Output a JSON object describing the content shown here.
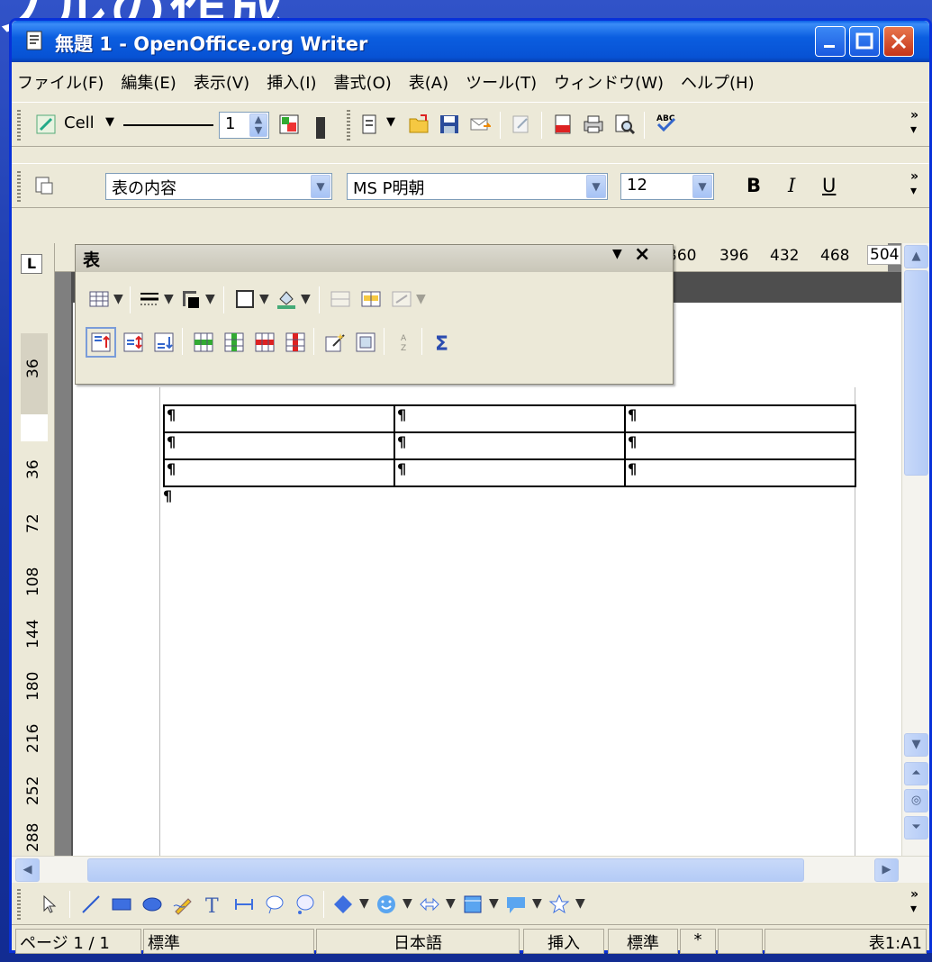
{
  "slide_title": "ブルの作成",
  "window": {
    "title": "無題 1 - OpenOffice.org Writer"
  },
  "menu": [
    "ファイル(F)",
    "編集(E)",
    "表示(V)",
    "挿入(I)",
    "書式(O)",
    "表(A)",
    "ツール(T)",
    "ウィンドウ(W)",
    "ヘルプ(H)"
  ],
  "table_toolbar": {
    "cell_label": "Cell",
    "line_width": "1"
  },
  "format_toolbar": {
    "style": "表の内容",
    "font": "MS P明朝",
    "size": "12",
    "bold": "B",
    "italic": "I",
    "underline": "U"
  },
  "horizontal_ruler": [
    "360",
    "396",
    "432",
    "468",
    "504"
  ],
  "vertical_ruler": [
    "36",
    "36",
    "72",
    "108",
    "144",
    "180",
    "216",
    "252",
    "288"
  ],
  "float_toolbar": {
    "title": "表"
  },
  "document": {
    "table_rows": [
      [
        "¶",
        "¶",
        "¶"
      ],
      [
        "¶",
        "¶",
        "¶"
      ],
      [
        "¶",
        "¶",
        "¶"
      ]
    ],
    "after_table": "¶"
  },
  "statusbar": {
    "page": "ページ 1 / 1",
    "style": "標準",
    "language": "日本語",
    "mode": "挿入",
    "selection": "標準",
    "modified": "*",
    "cell": "表1:A1"
  },
  "colors": {
    "titlebar": "#0752d4",
    "slide_bg": "#1c3ab0",
    "chrome": "#ece9d8"
  }
}
